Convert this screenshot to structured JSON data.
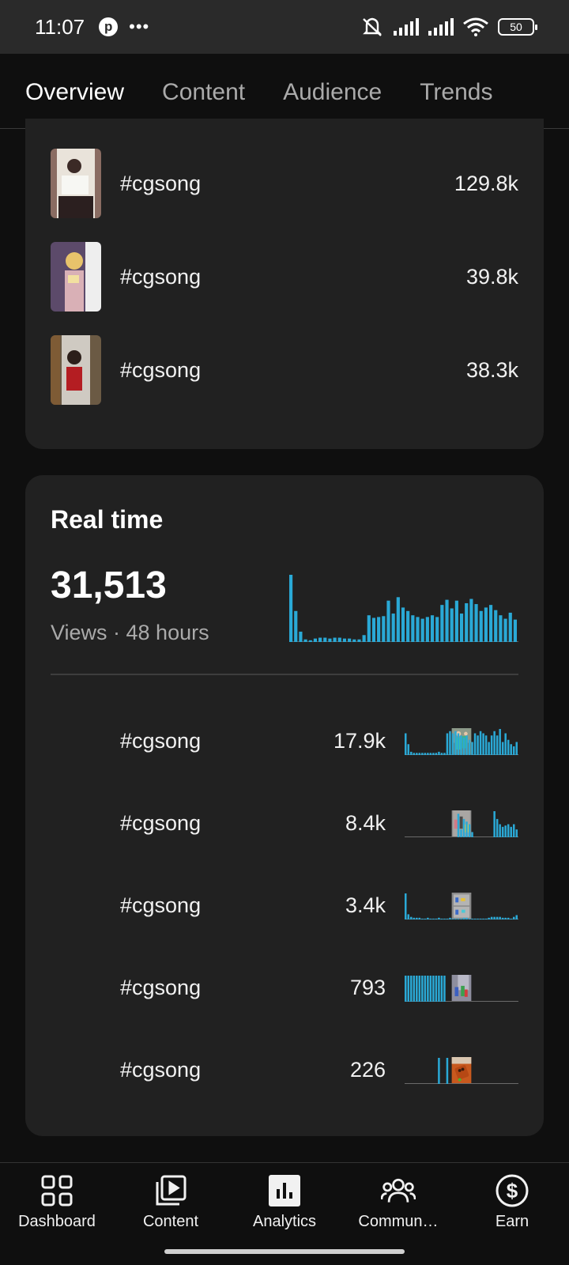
{
  "status_bar": {
    "time": "11:07",
    "battery": "50"
  },
  "tabs": [
    {
      "label": "Overview",
      "active": true
    },
    {
      "label": "Content",
      "active": false
    },
    {
      "label": "Audience",
      "active": false
    },
    {
      "label": "Trends",
      "active": false
    }
  ],
  "top_content": [
    {
      "title": "#cgsong",
      "value": "129.8k"
    },
    {
      "title": "#cgsong",
      "value": "39.8k"
    },
    {
      "title": "#cgsong",
      "value": "38.3k"
    }
  ],
  "realtime": {
    "heading": "Real time",
    "total": "31,513",
    "subtitle": "Views · 48 hours",
    "accent": "#2aa9d6",
    "main_hourly": [
      78,
      36,
      12,
      3,
      2,
      4,
      5,
      5,
      4,
      5,
      5,
      4,
      4,
      3,
      3,
      8,
      31,
      28,
      29,
      30,
      48,
      33,
      52,
      40,
      36,
      31,
      29,
      27,
      29,
      31,
      29,
      43,
      49,
      39,
      48,
      33,
      45,
      50,
      44,
      36,
      40,
      43,
      37,
      31,
      27,
      34,
      26
    ],
    "items": [
      {
        "title": "#cgsong",
        "value": "17.9k",
        "spark": [
          20,
          10,
          3,
          2,
          2,
          2,
          2,
          2,
          2,
          2,
          2,
          2,
          3,
          2,
          2,
          20,
          22,
          20,
          22,
          20,
          18,
          16,
          18,
          14,
          12,
          20,
          18,
          22,
          20,
          18,
          12,
          18,
          22,
          18,
          24,
          12,
          20,
          14,
          10,
          8,
          12
        ]
      },
      {
        "title": "#cgsong",
        "value": "8.4k",
        "spark": [
          0,
          0,
          0,
          0,
          0,
          0,
          0,
          0,
          0,
          0,
          0,
          0,
          0,
          0,
          0,
          0,
          0,
          0,
          0,
          18,
          6,
          14,
          12,
          10,
          4,
          0,
          0,
          0,
          0,
          0,
          0,
          0,
          20,
          14,
          10,
          8,
          9,
          10,
          8,
          10,
          6
        ]
      },
      {
        "title": "#cgsong",
        "value": "3.4k",
        "spark": [
          30,
          6,
          3,
          2,
          2,
          2,
          1,
          1,
          2,
          1,
          1,
          1,
          2,
          1,
          1,
          1,
          2,
          1,
          1,
          1,
          1,
          2,
          2,
          1,
          1,
          1,
          1,
          1,
          1,
          1,
          2,
          3,
          3,
          3,
          3,
          2,
          2,
          2,
          1,
          3,
          5
        ]
      },
      {
        "title": "#cgsong",
        "value": "793",
        "spark": [
          1,
          1,
          1,
          1,
          1,
          1,
          1,
          1,
          1,
          1,
          1,
          1,
          1,
          1,
          1,
          0,
          0,
          0,
          0,
          0,
          0,
          0,
          0,
          0,
          0,
          0,
          0,
          0,
          0,
          0,
          0,
          0,
          0,
          0,
          0,
          0,
          0,
          0,
          0,
          0,
          0
        ]
      },
      {
        "title": "#cgsong",
        "value": "226",
        "spark": [
          0,
          0,
          0,
          0,
          0,
          0,
          0,
          0,
          0,
          0,
          0,
          0,
          1,
          0,
          0,
          1,
          0,
          0,
          0,
          0,
          0,
          0,
          0,
          0,
          0,
          0,
          0,
          0,
          0,
          0,
          0,
          0,
          0,
          0,
          0,
          0,
          0,
          0,
          0,
          0,
          0
        ]
      }
    ]
  },
  "bottom_nav": [
    {
      "label": "Dashboard",
      "icon": "dashboard-icon"
    },
    {
      "label": "Content",
      "icon": "content-icon"
    },
    {
      "label": "Analytics",
      "icon": "analytics-icon",
      "active": true
    },
    {
      "label": "Commun…",
      "icon": "community-icon"
    },
    {
      "label": "Earn",
      "icon": "earn-icon"
    }
  ]
}
